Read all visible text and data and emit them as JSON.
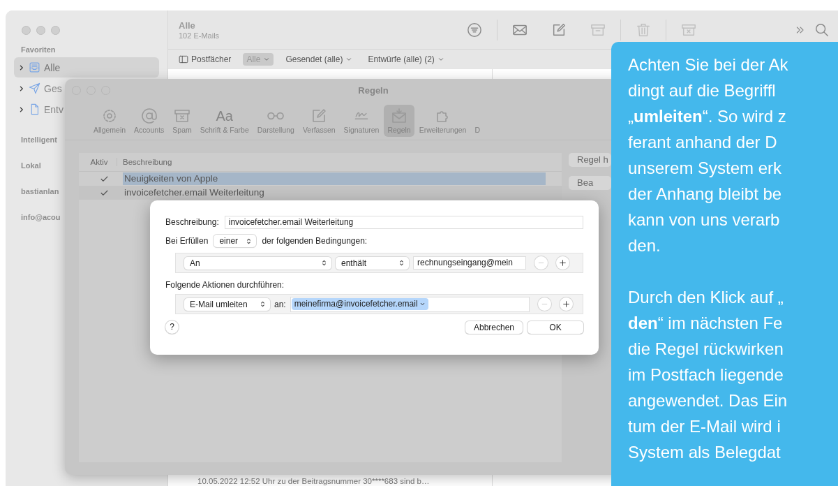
{
  "mail_window": {
    "title": "Alle",
    "subtitle": "102 E-Mails",
    "toolbar": [
      {
        "kind": "filter",
        "disabled": false
      },
      {
        "kind": "divider"
      },
      {
        "kind": "envelope",
        "disabled": false
      },
      {
        "kind": "compose",
        "disabled": false
      },
      {
        "kind": "archive",
        "disabled": true
      },
      {
        "kind": "divider"
      },
      {
        "kind": "trash",
        "disabled": true
      },
      {
        "kind": "divider"
      },
      {
        "kind": "junk",
        "disabled": true
      },
      {
        "kind": "more",
        "disabled": false
      },
      {
        "kind": "search",
        "disabled": false
      }
    ],
    "sidebar": [
      {
        "label": "Favoriten",
        "items": [
          {
            "label": "Alle",
            "kind": "inbox",
            "selected": true
          },
          {
            "label": "Ges",
            "kind": "sent",
            "selected": false
          },
          {
            "label": "Entv",
            "kind": "draft",
            "selected": false
          }
        ]
      },
      {
        "label": "Intelligent"
      },
      {
        "label": "Lokal"
      },
      {
        "label": "bastianlan"
      },
      {
        "label": "info@acou"
      }
    ],
    "filter_bar": [
      {
        "label": "Postfächer",
        "kind": "sidebar-toggle",
        "selected": false
      },
      {
        "label": "Alle",
        "kind": "menu",
        "selected": true
      },
      {
        "label": "Gesendet (alle)",
        "kind": "menu",
        "selected": false
      },
      {
        "label": "Entwürfe (alle) (2)",
        "kind": "menu",
        "selected": false
      }
    ],
    "message_preview": "10.05.2022 12:52 Uhr zu der Beitragsnummer 30****683 sind b…"
  },
  "preferences": {
    "title": "Regeln",
    "tabs": [
      {
        "label": "Allgemein",
        "kind": "gear",
        "selected": false
      },
      {
        "label": "Accounts",
        "kind": "at",
        "selected": false
      },
      {
        "label": "Spam",
        "kind": "junk",
        "selected": false
      },
      {
        "label": "Schrift & Farbe",
        "kind": "font",
        "glyph": "Aa",
        "selected": false
      },
      {
        "label": "Darstellung",
        "kind": "glasses",
        "selected": false
      },
      {
        "label": "Verfassen",
        "kind": "compose",
        "selected": false
      },
      {
        "label": "Signaturen",
        "kind": "signature",
        "selected": false
      },
      {
        "label": "Regeln",
        "kind": "rules",
        "selected": true
      },
      {
        "label": "Erweiterungen",
        "kind": "puzzle",
        "selected": false
      },
      {
        "label": "D",
        "kind": "none",
        "selected": false
      }
    ],
    "rules": {
      "columns": [
        "Aktiv",
        "Beschreibung"
      ],
      "rows": [
        {
          "active": true,
          "description": "Neuigkeiten von Apple",
          "selected": true
        },
        {
          "active": true,
          "description": "invoicefetcher.email Weiterleitung",
          "selected": false
        }
      ]
    },
    "buttons": [
      "Regel h",
      "Bea"
    ]
  },
  "sheet": {
    "description_label": "Beschreibung:",
    "description": "invoicefetcher.email Weiterleitung",
    "match_prefix": "Bei Erfüllen",
    "match_mode": "einer",
    "match_suffix": "der folgenden Bedingungen:",
    "conditions": [
      {
        "field": "An",
        "operator": "enthält",
        "value": "rechnungseingang@mein",
        "remove_disabled": true
      }
    ],
    "actions_label": "Folgende Aktionen durchführen:",
    "actions": [
      {
        "action": "E-Mail umleiten",
        "to_label": "an:",
        "recipient": "meinefirma@invoicefetcher.email",
        "remove_disabled": true
      }
    ],
    "help": "?",
    "buttons": [
      "Abbrechen",
      "OK"
    ]
  },
  "callout": {
    "paragraphs": [
      [
        "Achten Sie bei der Ak",
        "dingt auf die Begriffl",
        "„**umleiten**“. So wird z",
        "ferant anhand der D",
        "unserem System erk",
        "der Anhang bleibt be",
        "kann von uns verarb",
        "den."
      ],
      [
        "Durch den Klick auf „",
        "**den**“ im nächsten Fe",
        "die Regel rückwirken",
        "im Postfach liegende",
        "angewendet. Das Ein",
        "tum der E-Mail wird i",
        "System als Belegdat"
      ]
    ]
  }
}
